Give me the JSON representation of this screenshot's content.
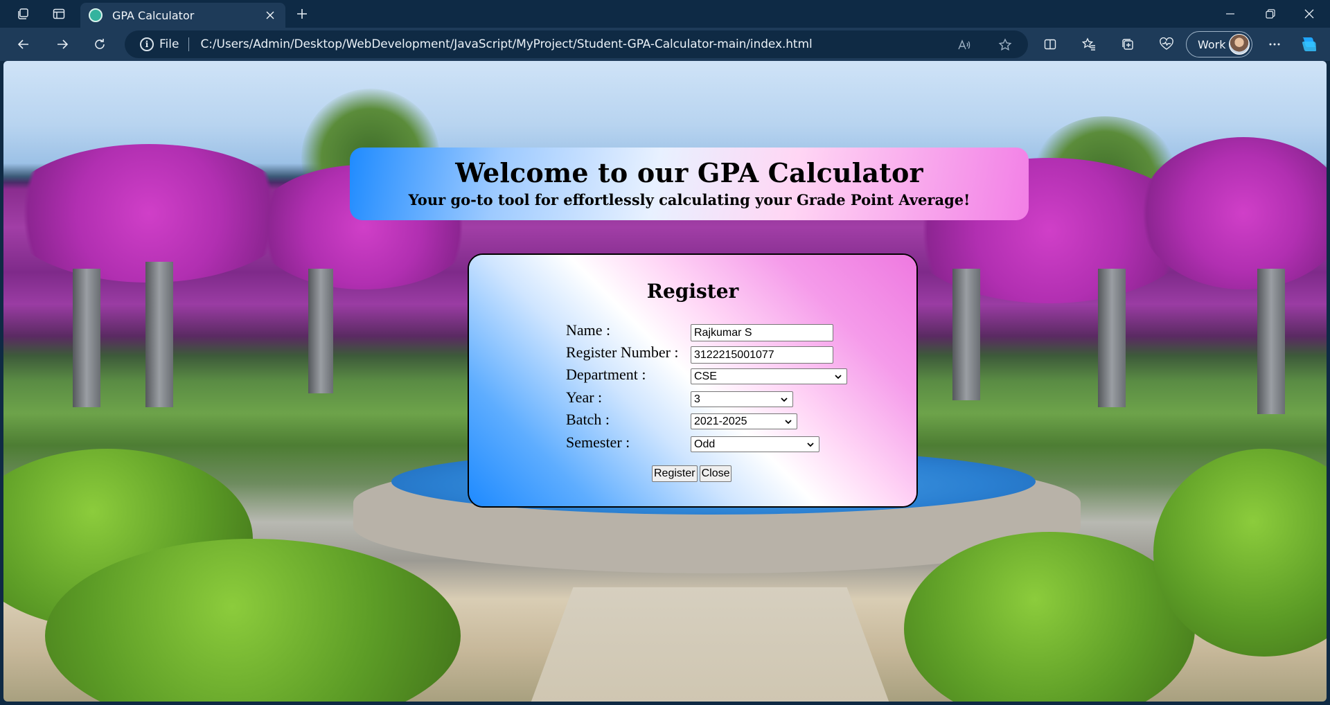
{
  "browser": {
    "tab": {
      "title": "GPA Calculator",
      "favicon": "calculator-favicon"
    },
    "address": {
      "scheme_label": "File",
      "url": "C:/Users/Admin/Desktop/WebDevelopment/JavaScript/MyProject/Student-GPA-Calculator-main/index.html"
    },
    "profile": {
      "label": "Work"
    },
    "icons": [
      "workspaces-icon",
      "tab-actions-icon",
      "close-icon",
      "plus-icon",
      "minimize-icon",
      "restore-icon",
      "back-icon",
      "forward-icon",
      "refresh-icon",
      "info-icon",
      "read-aloud-icon",
      "favorite-star-icon",
      "split-screen-icon",
      "favorites-icon",
      "collections-icon",
      "browser-essentials-icon",
      "more-icon",
      "copilot-icon"
    ]
  },
  "page": {
    "banner": {
      "title": "Welcome to our GPA Calculator",
      "subtitle": "Your go-to tool for effortlessly calculating your Grade Point Average!"
    },
    "register": {
      "title": "Register",
      "fields": {
        "name": {
          "label": "Name :",
          "value": "Rajkumar S"
        },
        "register_number": {
          "label": "Register Number :",
          "value": "3122215001077"
        },
        "department": {
          "label": "Department :",
          "value": "CSE"
        },
        "year": {
          "label": "Year :",
          "value": "3"
        },
        "batch": {
          "label": "Batch :",
          "value": "2021-2025"
        },
        "semester": {
          "label": "Semester :",
          "value": "Odd"
        }
      },
      "buttons": {
        "register": "Register",
        "close": "Close"
      }
    }
  },
  "colors": {
    "chrome_dark": "#0e2a45",
    "chrome_toolbar": "#1e3b59",
    "banner_gradient_start": "#1f8bff",
    "banner_gradient_end": "#f27fe6"
  }
}
